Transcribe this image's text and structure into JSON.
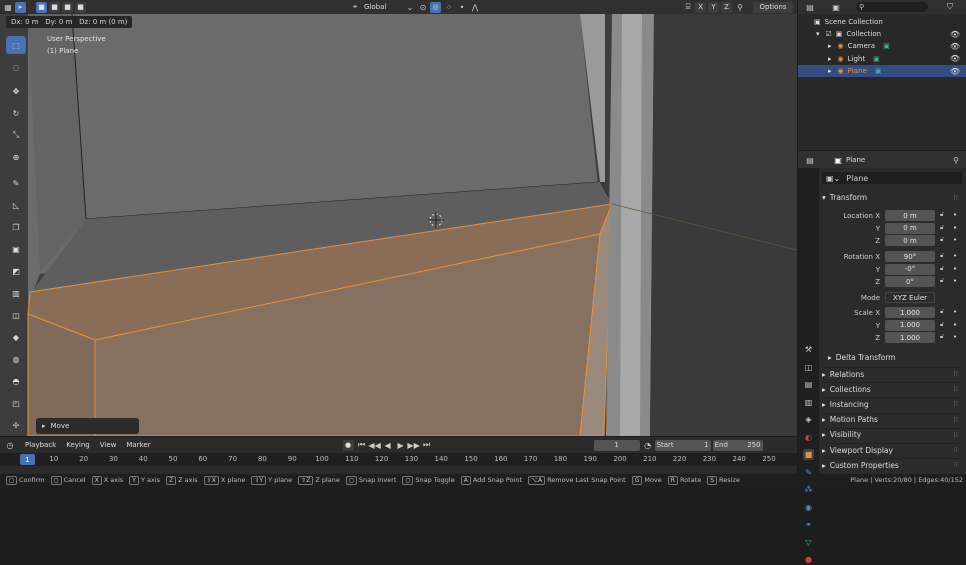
{
  "viewport": {
    "drag_info": "Dx: 0 m   Dy: 0 m   Dz: 0 m (0 m)",
    "perspective": "User Perspective",
    "object": "(1) Plane",
    "transform_orientation": "Global",
    "axes": [
      "X",
      "Y",
      "Z"
    ],
    "options_label": "Options",
    "operator_panel": "Move"
  },
  "timeline": {
    "menus": [
      "Playback",
      "Keying",
      "View",
      "Marker"
    ],
    "current_frame": "1",
    "start_label": "Start",
    "start": "1",
    "end_label": "End",
    "end": "250",
    "ruler_ticks": [
      "1",
      "10",
      "20",
      "30",
      "40",
      "50",
      "60",
      "70",
      "80",
      "90",
      "100",
      "110",
      "120",
      "130",
      "140",
      "150",
      "160",
      "170",
      "180",
      "190",
      "200",
      "210",
      "220",
      "230",
      "240",
      "250"
    ]
  },
  "statusbar": {
    "items": [
      {
        "key": "",
        "label": "Confirm"
      },
      {
        "key": "",
        "label": "Cancel"
      },
      {
        "key": "X",
        "label": "X axis"
      },
      {
        "key": "Y",
        "label": "Y axis"
      },
      {
        "key": "Z",
        "label": "Z axis"
      },
      {
        "key": "⇧X",
        "label": "X plane"
      },
      {
        "key": "⇧Y",
        "label": "Y plane"
      },
      {
        "key": "⇧Z",
        "label": "Z plane"
      },
      {
        "key": "",
        "label": "Snap Invert"
      },
      {
        "key": "",
        "label": "Snap Toggle"
      },
      {
        "key": "A",
        "label": "Add Snap Point"
      },
      {
        "key": "⌥A",
        "label": "Remove Last Snap Point"
      },
      {
        "key": "G",
        "label": "Move"
      },
      {
        "key": "R",
        "label": "Rotate"
      },
      {
        "key": "S",
        "label": "Resize"
      }
    ],
    "stats": "Plane | Verts:20/80 | Edges:40/152"
  },
  "outliner": {
    "root": "Scene Collection",
    "collection": "Collection",
    "items": [
      {
        "name": "Camera",
        "selected": false,
        "color": "#e6903b"
      },
      {
        "name": "Light",
        "selected": false,
        "color": "#e6903b"
      },
      {
        "name": "Plane",
        "selected": true,
        "color": "#e6903b"
      }
    ]
  },
  "properties": {
    "object_name": "Plane",
    "datablock_name": "Plane",
    "transform_title": "Transform",
    "location_label": "Location X",
    "location": [
      "0 m",
      "0 m",
      "0 m"
    ],
    "rotation_label": "Rotation X",
    "rotation": [
      "90°",
      "-0°",
      "0°"
    ],
    "mode_label": "Mode",
    "mode": "XYZ Euler",
    "scale_label": "Scale X",
    "scale": [
      "1.000",
      "1.000",
      "1.000"
    ],
    "y_label": "Y",
    "z_label": "Z",
    "delta_transform": "Delta Transform",
    "panels": [
      "Relations",
      "Collections",
      "Instancing",
      "Motion Paths",
      "Visibility",
      "Viewport Display",
      "Custom Properties"
    ]
  },
  "colors": {
    "accent": "#4772b3",
    "selection": "#e6903b",
    "viewport_bg": "#3d3d3d"
  }
}
